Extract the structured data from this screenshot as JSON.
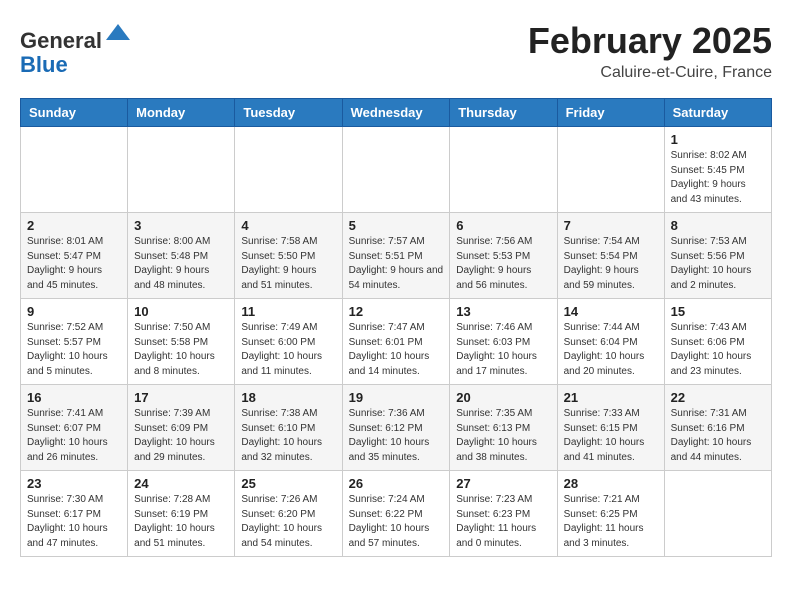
{
  "header": {
    "logo_general": "General",
    "logo_blue": "Blue",
    "month_year": "February 2025",
    "location": "Caluire-et-Cuire, France"
  },
  "weekdays": [
    "Sunday",
    "Monday",
    "Tuesday",
    "Wednesday",
    "Thursday",
    "Friday",
    "Saturday"
  ],
  "weeks": [
    [
      {
        "day": "",
        "info": ""
      },
      {
        "day": "",
        "info": ""
      },
      {
        "day": "",
        "info": ""
      },
      {
        "day": "",
        "info": ""
      },
      {
        "day": "",
        "info": ""
      },
      {
        "day": "",
        "info": ""
      },
      {
        "day": "1",
        "info": "Sunrise: 8:02 AM\nSunset: 5:45 PM\nDaylight: 9 hours and 43 minutes."
      }
    ],
    [
      {
        "day": "2",
        "info": "Sunrise: 8:01 AM\nSunset: 5:47 PM\nDaylight: 9 hours and 45 minutes."
      },
      {
        "day": "3",
        "info": "Sunrise: 8:00 AM\nSunset: 5:48 PM\nDaylight: 9 hours and 48 minutes."
      },
      {
        "day": "4",
        "info": "Sunrise: 7:58 AM\nSunset: 5:50 PM\nDaylight: 9 hours and 51 minutes."
      },
      {
        "day": "5",
        "info": "Sunrise: 7:57 AM\nSunset: 5:51 PM\nDaylight: 9 hours and 54 minutes."
      },
      {
        "day": "6",
        "info": "Sunrise: 7:56 AM\nSunset: 5:53 PM\nDaylight: 9 hours and 56 minutes."
      },
      {
        "day": "7",
        "info": "Sunrise: 7:54 AM\nSunset: 5:54 PM\nDaylight: 9 hours and 59 minutes."
      },
      {
        "day": "8",
        "info": "Sunrise: 7:53 AM\nSunset: 5:56 PM\nDaylight: 10 hours and 2 minutes."
      }
    ],
    [
      {
        "day": "9",
        "info": "Sunrise: 7:52 AM\nSunset: 5:57 PM\nDaylight: 10 hours and 5 minutes."
      },
      {
        "day": "10",
        "info": "Sunrise: 7:50 AM\nSunset: 5:58 PM\nDaylight: 10 hours and 8 minutes."
      },
      {
        "day": "11",
        "info": "Sunrise: 7:49 AM\nSunset: 6:00 PM\nDaylight: 10 hours and 11 minutes."
      },
      {
        "day": "12",
        "info": "Sunrise: 7:47 AM\nSunset: 6:01 PM\nDaylight: 10 hours and 14 minutes."
      },
      {
        "day": "13",
        "info": "Sunrise: 7:46 AM\nSunset: 6:03 PM\nDaylight: 10 hours and 17 minutes."
      },
      {
        "day": "14",
        "info": "Sunrise: 7:44 AM\nSunset: 6:04 PM\nDaylight: 10 hours and 20 minutes."
      },
      {
        "day": "15",
        "info": "Sunrise: 7:43 AM\nSunset: 6:06 PM\nDaylight: 10 hours and 23 minutes."
      }
    ],
    [
      {
        "day": "16",
        "info": "Sunrise: 7:41 AM\nSunset: 6:07 PM\nDaylight: 10 hours and 26 minutes."
      },
      {
        "day": "17",
        "info": "Sunrise: 7:39 AM\nSunset: 6:09 PM\nDaylight: 10 hours and 29 minutes."
      },
      {
        "day": "18",
        "info": "Sunrise: 7:38 AM\nSunset: 6:10 PM\nDaylight: 10 hours and 32 minutes."
      },
      {
        "day": "19",
        "info": "Sunrise: 7:36 AM\nSunset: 6:12 PM\nDaylight: 10 hours and 35 minutes."
      },
      {
        "day": "20",
        "info": "Sunrise: 7:35 AM\nSunset: 6:13 PM\nDaylight: 10 hours and 38 minutes."
      },
      {
        "day": "21",
        "info": "Sunrise: 7:33 AM\nSunset: 6:15 PM\nDaylight: 10 hours and 41 minutes."
      },
      {
        "day": "22",
        "info": "Sunrise: 7:31 AM\nSunset: 6:16 PM\nDaylight: 10 hours and 44 minutes."
      }
    ],
    [
      {
        "day": "23",
        "info": "Sunrise: 7:30 AM\nSunset: 6:17 PM\nDaylight: 10 hours and 47 minutes."
      },
      {
        "day": "24",
        "info": "Sunrise: 7:28 AM\nSunset: 6:19 PM\nDaylight: 10 hours and 51 minutes."
      },
      {
        "day": "25",
        "info": "Sunrise: 7:26 AM\nSunset: 6:20 PM\nDaylight: 10 hours and 54 minutes."
      },
      {
        "day": "26",
        "info": "Sunrise: 7:24 AM\nSunset: 6:22 PM\nDaylight: 10 hours and 57 minutes."
      },
      {
        "day": "27",
        "info": "Sunrise: 7:23 AM\nSunset: 6:23 PM\nDaylight: 11 hours and 0 minutes."
      },
      {
        "day": "28",
        "info": "Sunrise: 7:21 AM\nSunset: 6:25 PM\nDaylight: 11 hours and 3 minutes."
      },
      {
        "day": "",
        "info": ""
      }
    ]
  ]
}
